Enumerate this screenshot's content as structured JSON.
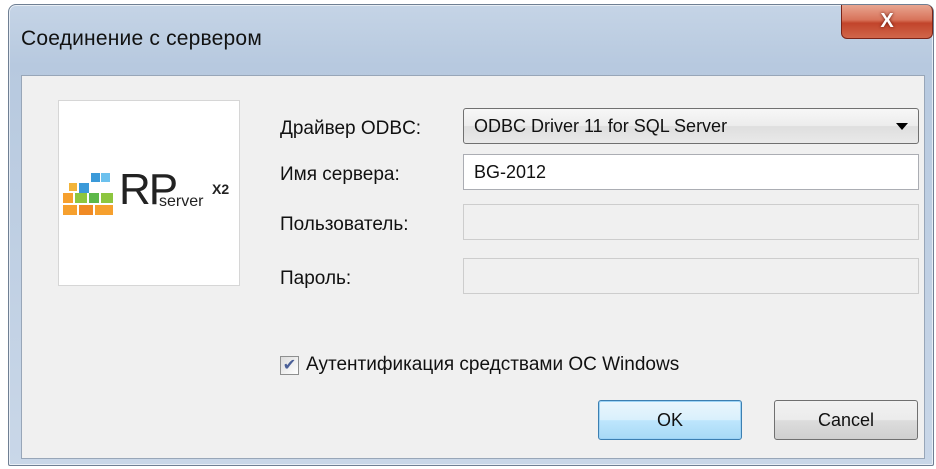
{
  "window": {
    "title": "Соединение с сервером",
    "close_glyph": "X"
  },
  "logo": {
    "rp": "RP",
    "server": "server",
    "x2": "X2"
  },
  "form": {
    "driver_label": "Драйвер ODBC:",
    "driver_value": "ODBC Driver 11 for SQL Server",
    "server_label": "Имя сервера:",
    "server_value": "BG-2012",
    "user_label": "Пользователь:",
    "user_value": "",
    "password_label": "Пароль:",
    "password_value": "",
    "windows_auth_label": "Аутентификация средствами ОС Windows",
    "windows_auth_checked": true
  },
  "buttons": {
    "ok": "OK",
    "cancel": "Cancel"
  },
  "colors": {
    "close_button": "#c2442b",
    "default_button_border": "#3c7fb1",
    "checkmark": "#4a5f97"
  },
  "icons": {
    "close": "close-icon",
    "dropdown": "chevron-down-icon",
    "check": "checkmark-icon"
  }
}
